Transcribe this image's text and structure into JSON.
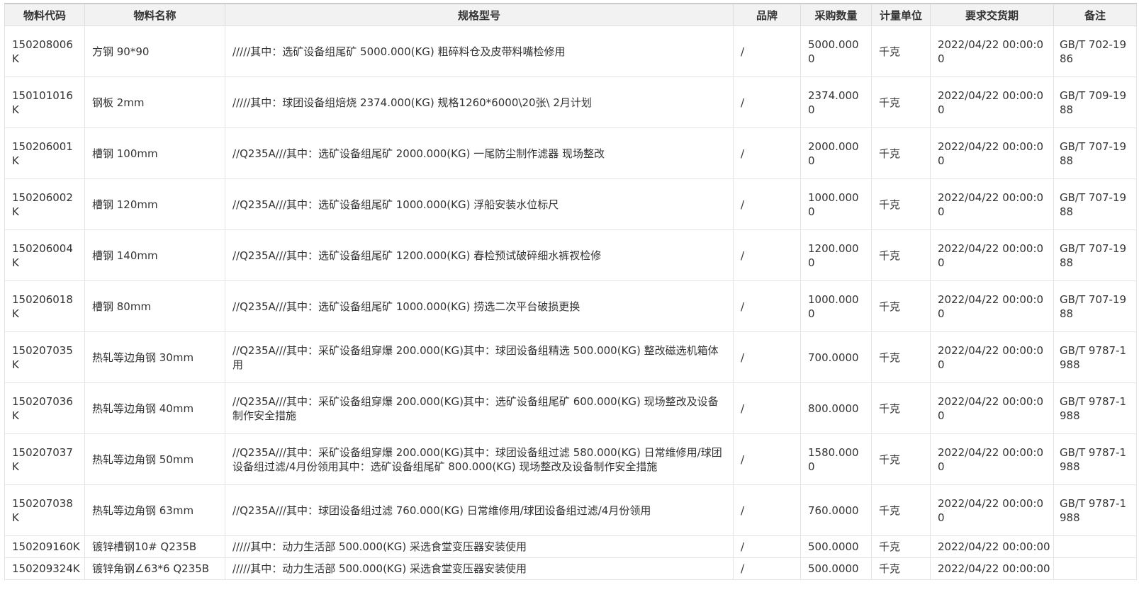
{
  "table": {
    "headers": [
      "物料代码",
      "物料名称",
      "规格型号",
      "品牌",
      "采购数量",
      "计量单位",
      "要求交货期",
      "备注"
    ],
    "rows": [
      {
        "code": "150208006K",
        "name": "方钢 90*90",
        "spec": "/////其中：选矿设备组尾矿 5000.000(KG) 粗碎料仓及皮带料嘴检修用",
        "brand": "/",
        "qty": "5000.0000",
        "unit": "千克",
        "date": "2022/04/22 00:00:00",
        "remark": "GB/T 702-1986"
      },
      {
        "code": "150101016K",
        "name": "钢板 2mm",
        "spec": "/////其中：球团设备组焙烧 2374.000(KG) 规格1260*6000\\20张\\ 2月计划",
        "brand": "/",
        "qty": "2374.0000",
        "unit": "千克",
        "date": "2022/04/22 00:00:00",
        "remark": "GB/T 709-1988"
      },
      {
        "code": "150206001K",
        "name": "槽钢 100mm",
        "spec": "//Q235A///其中：选矿设备组尾矿 2000.000(KG) 一尾防尘制作滤器 现场整改",
        "brand": "/",
        "qty": "2000.0000",
        "unit": "千克",
        "date": "2022/04/22 00:00:00",
        "remark": "GB/T 707-1988"
      },
      {
        "code": "150206002K",
        "name": "槽钢 120mm",
        "spec": "//Q235A///其中：选矿设备组尾矿 1000.000(KG) 浮船安装水位标尺",
        "brand": "/",
        "qty": "1000.0000",
        "unit": "千克",
        "date": "2022/04/22 00:00:00",
        "remark": "GB/T 707-1988"
      },
      {
        "code": "150206004K",
        "name": "槽钢 140mm",
        "spec": "//Q235A///其中：选矿设备组尾矿 1200.000(KG) 春检预试破碎细水裤衩检修",
        "brand": "/",
        "qty": "1200.0000",
        "unit": "千克",
        "date": "2022/04/22 00:00:00",
        "remark": "GB/T 707-1988"
      },
      {
        "code": "150206018K",
        "name": "槽钢 80mm",
        "spec": "//Q235A///其中：选矿设备组尾矿 1000.000(KG) 捞选二次平台破损更换",
        "brand": "/",
        "qty": "1000.0000",
        "unit": "千克",
        "date": "2022/04/22 00:00:00",
        "remark": "GB/T 707-1988"
      },
      {
        "code": "150207035K",
        "name": "热轧等边角钢 30mm",
        "spec": "//Q235A///其中：采矿设备组穿爆 200.000(KG)其中：球团设备组精选 500.000(KG) 整改磁选机箱体用",
        "brand": "/",
        "qty": "700.0000",
        "unit": "千克",
        "date": "2022/04/22 00:00:00",
        "remark": "GB/T 9787-1988"
      },
      {
        "code": "150207036K",
        "name": "热轧等边角钢 40mm",
        "spec": "//Q235A///其中：采矿设备组穿爆 200.000(KG)其中：选矿设备组尾矿 600.000(KG) 现场整改及设备制作安全措施",
        "brand": "/",
        "qty": "800.0000",
        "unit": "千克",
        "date": "2022/04/22 00:00:00",
        "remark": "GB/T 9787-1988"
      },
      {
        "code": "150207037K",
        "name": "热轧等边角钢 50mm",
        "spec": "//Q235A///其中：采矿设备组穿爆 200.000(KG)其中：球团设备组过滤 580.000(KG) 日常维修用/球团设备组过滤/4月份领用其中：选矿设备组尾矿 800.000(KG) 现场整改及设备制作安全措施",
        "brand": "/",
        "qty": "1580.0000",
        "unit": "千克",
        "date": "2022/04/22 00:00:00",
        "remark": "GB/T 9787-1988"
      },
      {
        "code": "150207038K",
        "name": "热轧等边角钢 63mm",
        "spec": "//Q235A///其中：球团设备组过滤 760.000(KG) 日常维修用/球团设备组过滤/4月份领用",
        "brand": "/",
        "qty": "760.0000",
        "unit": "千克",
        "date": "2022/04/22 00:00:00",
        "remark": "GB/T 9787-1988"
      },
      {
        "code": "150209160K",
        "name": "镀锌槽钢10# Q235B",
        "spec": "/////其中：动力生活部 500.000(KG) 采选食堂变压器安装使用",
        "brand": "/",
        "qty": "500.0000",
        "unit": "千克",
        "date": "2022/04/22 00:00:00",
        "remark": ""
      },
      {
        "code": "150209324K",
        "name": "镀锌角钢∠63*6 Q235B",
        "spec": "/////其中：动力生活部 500.000(KG) 采选食堂变压器安装使用",
        "brand": "/",
        "qty": "500.0000",
        "unit": "千克",
        "date": "2022/04/22 00:00:00",
        "remark": ""
      }
    ]
  }
}
